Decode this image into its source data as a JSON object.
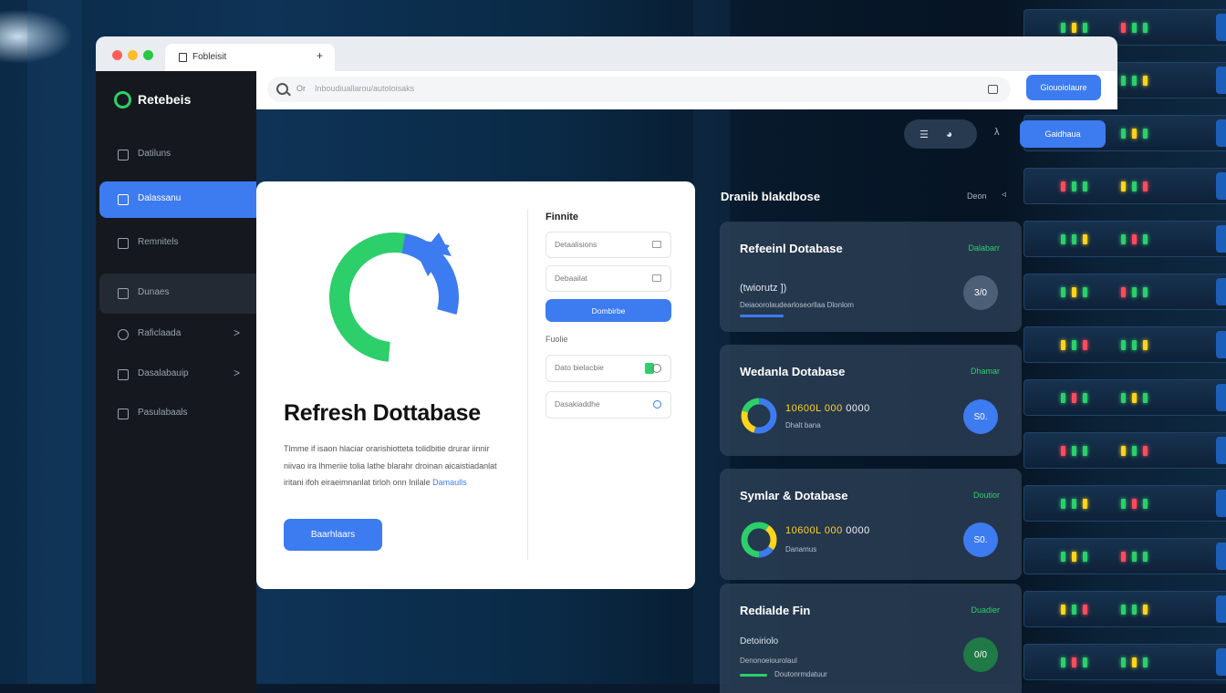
{
  "window": {
    "tab_title": "Fobleisit",
    "tab_close": "+"
  },
  "address": {
    "q_label": "Or",
    "placeholder": "Inboudiuallarou/autoloisaks",
    "action_label": "Giouoiolaure"
  },
  "sidebar": {
    "brand": "Retebeis",
    "items": [
      {
        "label": "Datiluns",
        "icon": "dashboard-icon",
        "chevron": ""
      },
      {
        "label": "Dalassanu",
        "icon": "database-icon",
        "chevron": ""
      },
      {
        "label": "Remnitels",
        "icon": "terminal-icon",
        "chevron": ""
      },
      {
        "label": "Dunaes",
        "icon": "grid-icon",
        "chevron": ""
      },
      {
        "label": "Raficlaada",
        "icon": "settings-icon",
        "chevron": ">"
      },
      {
        "label": "Dasalabauip",
        "icon": "table-icon",
        "chevron": ">"
      },
      {
        "label": "Pasulabaals",
        "icon": "box-icon",
        "chevron": ""
      }
    ]
  },
  "toolbar": {
    "menu_glyph": "☰",
    "palette_glyph": "◕",
    "lambda_glyph": "λ",
    "action_label": "Gaidhaua"
  },
  "main_card": {
    "title": "Refresh Dottabase",
    "description": "Tlmme if isaon hlaciar orarishiotteta tolidbitie drurar iinnir niivao ira lhmeriie tolia lathe blarahr droinan aicaistiadanlat iritani ifoh eiraeimnanlat tirloh onn Inilale",
    "description_link": "Damaulls",
    "button_label": "Baarhlaars",
    "form": {
      "heading": "Finnite",
      "field1": "Detaalisions",
      "field2": "Debaailat",
      "button": "Dombirbe",
      "subheading": "Fuolie",
      "toggle_label": "Dato bielacbie",
      "radio_label": "Dasakiaddhe"
    }
  },
  "panel": {
    "heading": "Dranib blakdbose",
    "right_text": "Deon",
    "right_glyph": "◃",
    "cards": [
      {
        "title": "Refeeinl Dotabase",
        "status": "Dalabarr",
        "line1": "(twiorutz ])",
        "line2": "Deiaoorolaudearloseorllaa Dlonlom",
        "circle_label": "3/0",
        "progress": 0.55
      },
      {
        "title": "Wedanla Dotabase",
        "status": "Dhamar",
        "value_yellow": "10600L 000",
        "value_white": "0000",
        "sub": "Dhalt bana",
        "circle_label": "S0.",
        "donut": [
          0.55,
          0.25,
          0.2
        ]
      },
      {
        "title": "Symlar & Dotabase",
        "status": "Doutior",
        "value_yellow": "10600L 000",
        "value_white": "0000",
        "sub": "Danamus",
        "circle_label": "S0.",
        "donut": [
          0.6,
          0.25,
          0.15
        ]
      },
      {
        "title": "Redialde Fin",
        "status": "Duadier",
        "line1": "Detoiriolo",
        "line2": "Denonoeiourolaul",
        "line3": "Doutonrmdatuur",
        "circle_label": "0/0",
        "progress": 0.6
      }
    ]
  },
  "colors": {
    "accent": "#3d7bf0",
    "success": "#2ccf6a",
    "warning": "#ffd41a"
  }
}
